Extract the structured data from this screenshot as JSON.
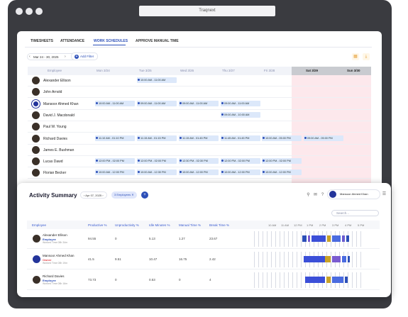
{
  "browser": {
    "url": "Traqnext"
  },
  "schedule": {
    "tabs": [
      "TIMESHEETS",
      "ATTENDANCE",
      "WORK SCHEDULES",
      "APPROVE MANUAL TIME"
    ],
    "active_tab": "WORK SCHEDULES",
    "date_range": "Mar 24 - 30, 2025",
    "add_filter": "Add Filter",
    "columns": [
      "Employee",
      "Mon 3/24",
      "Tue 3/25",
      "Wed 3/26",
      "Thu 3/27",
      "Fri 3/28",
      "Sat 3/29",
      "Sun 3/30"
    ],
    "rows": [
      {
        "name": "Alexander Ellison",
        "shifts": [
          "",
          "10:00 AM - 11:00 AM",
          "",
          "",
          "",
          ""
        ]
      },
      {
        "name": "John Arnold",
        "shifts": [
          "",
          "",
          "",
          "",
          "",
          ""
        ]
      },
      {
        "name": "Mansoor Ahmed Khan",
        "shifts": [
          "10:00 AM - 11:00 AM",
          "09:00 AM - 11:00 AM",
          "09:00 AM - 11:00 AM",
          "09:00 AM - 11:00 AM",
          "",
          ""
        ]
      },
      {
        "name": "David J. Macdonald",
        "shifts": [
          "",
          "",
          "",
          "09:00 AM - 10:00 AM",
          "",
          ""
        ]
      },
      {
        "name": "Paul W. Young",
        "shifts": [
          "",
          "",
          "",
          "",
          "",
          ""
        ]
      },
      {
        "name": "Richard Davies",
        "shifts": [
          "11:10 AM - 01:10 PM",
          "11:15 AM - 01:15 PM",
          "11:15 AM - 01:45 PM",
          "11:45 AM - 01:45 PM",
          "10:00 AM - 05:00 PM",
          "09:00 AM - 05:00 PM"
        ]
      },
      {
        "name": "James E. Bushman",
        "shifts": [
          "",
          "",
          "",
          "",
          "",
          ""
        ]
      },
      {
        "name": "Lucas Dawd",
        "shifts": [
          "12:00 PM - 02:00 PM",
          "12:00 PM - 02:00 PM",
          "12:30 PM - 02:30 PM",
          "12:00 PM - 02:00 PM",
          "12:00 PM - 02:00 PM",
          ""
        ]
      },
      {
        "name": "Florian Becker",
        "shifts": [
          "10:00 AM - 12:00 PM",
          "10:00 AM - 12:30 PM",
          "10:00 AM - 12:00 PM",
          "10:00 AM - 12:00 PM",
          "10:00 AM - 12:00 PM",
          ""
        ]
      }
    ]
  },
  "activity": {
    "title": "Activity Summary",
    "date": "Apr 07, 2025",
    "employees_filter": "3 Employees",
    "user_name": "Mansoor Ahmed Khan",
    "search_placeholder": "Search...",
    "columns": [
      "Employee",
      "Productive %",
      "Unproductivity %",
      "Idle Minutes %",
      "Manual Time %",
      "Break Time %"
    ],
    "timeline_ticks": [
      "10 AM",
      "11 AM",
      "12 PM",
      "1 PM",
      "2 PM",
      "3 PM",
      "4 PM",
      "5 PM"
    ],
    "rows": [
      {
        "name": "Alexander Ellison",
        "role": "Employee",
        "role_color": "#2c4fb8",
        "worked": "Worked Time 08h 34m",
        "productive": "94.55",
        "unproductive": "0",
        "idle": "5.13",
        "manual": "1.27",
        "break": "23.67"
      },
      {
        "name": "Mansoor Ahmed Khan",
        "role": "Owner",
        "role_color": "#e5484d",
        "worked": "Worked Time 08h 19m",
        "productive": "41.5",
        "unproductive": "9.51",
        "idle": "10.47",
        "manual": "16.75",
        "break": "2.42"
      },
      {
        "name": "Richard Davies",
        "role": "Employee",
        "role_color": "#2c4fb8",
        "worked": "Worked Time 08h 16m",
        "productive": "73.73",
        "unproductive": "0",
        "idle": "0.53",
        "manual": "0",
        "break": "4"
      }
    ]
  }
}
